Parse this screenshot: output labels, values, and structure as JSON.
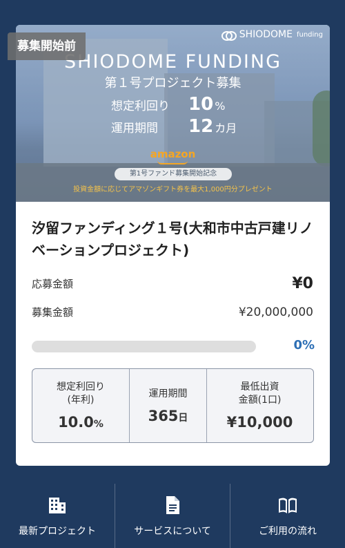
{
  "card": {
    "status_badge": "募集開始前",
    "hero": {
      "logo_text": "SHIODOME",
      "logo_small": "funding",
      "title": "SHIODOME FUNDING",
      "subtitle": "第１号プロジェクト募集",
      "yield_label": "想定利回り",
      "yield_value": "10",
      "yield_unit": "%",
      "period_label": "運用期間",
      "period_value": "12",
      "period_unit": "カ月",
      "amazon_text": "amazon",
      "pill_text": "第1号ファンド募集開始記念",
      "promo_text": "投資金額に応じてアマゾンギフト券を最大1,000円分プレゼント"
    },
    "title": "汐留ファンディング１号(大和市中古戸建リノベーションプロジェクト)",
    "applied_label": "応募金額",
    "applied_value": "¥0",
    "target_label": "募集金額",
    "target_value": "¥20,000,000",
    "progress_fraction": 0.0,
    "progress_pct": "0%",
    "stats": [
      {
        "label": "想定利回り\n(年利)",
        "value": "10.0",
        "unit": "%"
      },
      {
        "label": "運用期間",
        "value": "365",
        "unit": "日"
      },
      {
        "label": "最低出資\n金額(1口)",
        "value": "¥10,000",
        "unit": ""
      }
    ]
  },
  "nav": [
    {
      "label": "最新プロジェクト",
      "icon": "building-icon"
    },
    {
      "label": "サービスについて",
      "icon": "document-icon"
    },
    {
      "label": "ご利用の流れ",
      "icon": "book-icon"
    }
  ],
  "colors": {
    "background": "#1f3a5f",
    "accent": "#2d6fb5"
  }
}
